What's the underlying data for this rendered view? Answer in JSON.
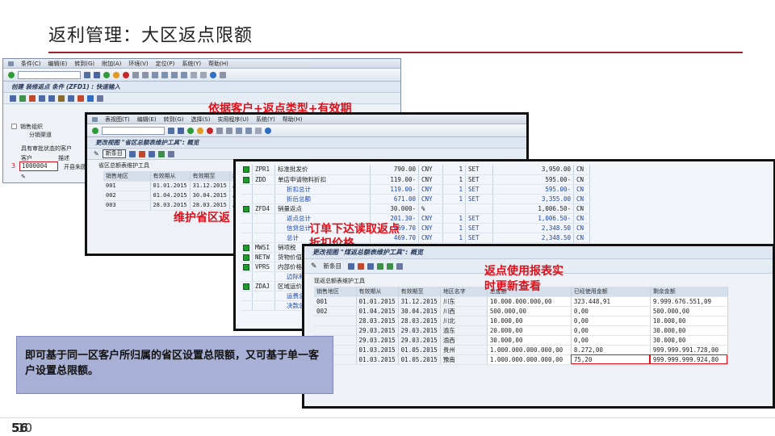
{
  "slide": {
    "title": "返利管理：大区返点限额",
    "page_number": "56",
    "page_number_overlay": "10"
  },
  "annotations": {
    "a1": "依据客户+返点类型+有效期",
    "a2": "维护省区返",
    "a3_line1": "订单下达读取返点",
    "a3_line2": "折扣价格",
    "a4_line1": "返点使用报表实",
    "a4_line2": "时更新查看"
  },
  "note": {
    "text": "即可基于同一区客户所归属的省区设置总限额，又可基于单一客户设置总限额。"
  },
  "win1": {
    "menu": [
      "条件(C)",
      "编辑(E)",
      "转到(G)",
      "附加(A)",
      "环境(V)",
      "定位(P)",
      "系统(Y)",
      "帮助(H)"
    ],
    "title": "创建 装修返点 条件 (ZFD1) : 快速输入",
    "field1_label": "销售组织",
    "field2_label": "分销渠道",
    "section_label": "具有审批状态的客户",
    "col_customer": "客户",
    "col_desc": "描述",
    "customer_value": "1000004",
    "customer_desc": "开县朱圆",
    "row_marker": "3"
  },
  "win2": {
    "menu": [
      "表视图(T)",
      "编辑(E)",
      "转到(G)",
      "选择(S)",
      "实用程序(U)",
      "系统(Y)",
      "帮助(H)"
    ],
    "title": "更改视图 \"省区总额表维护工具\": 概览",
    "new_entry": "新条目",
    "table_title": "省区总额表维护工具",
    "headers": [
      "销售地区",
      "有效期从",
      "有效期至",
      "地区名字"
    ],
    "rows": [
      [
        "001",
        "01.01.2015",
        "31.12.2015",
        "川东"
      ],
      [
        "002",
        "01.04.2015",
        "30.04.2015",
        "川西"
      ],
      [
        "003",
        "28.03.2015",
        "28.03.2015",
        "川北"
      ]
    ]
  },
  "win3": {
    "rows": [
      {
        "code": "ZPR1",
        "desc": "标准批发价",
        "amount": "790.00",
        "cur": "CNY",
        "per": "1",
        "unit": "SET",
        "value": "3,950.00",
        "cur2": "CN",
        "green": true,
        "blue": false
      },
      {
        "code": "ZDD",
        "desc": "单店申请物料折扣",
        "amount": "119.00-",
        "cur": "CNY",
        "per": "1",
        "unit": "SET",
        "value": "595.00-",
        "cur2": "CN",
        "green": true,
        "blue": false
      },
      {
        "code": "",
        "desc": "折扣总计",
        "amount": "119.00-",
        "cur": "CNY",
        "per": "1",
        "unit": "SET",
        "value": "595.00-",
        "cur2": "CN",
        "green": false,
        "blue": true
      },
      {
        "code": "",
        "desc": "折后总额",
        "amount": "671.00",
        "cur": "CNY",
        "per": "1",
        "unit": "SET",
        "value": "3,355.00",
        "cur2": "CN",
        "green": false,
        "blue": true
      },
      {
        "code": "ZFD4",
        "desc": "销量返点",
        "amount": "30.000-",
        "cur": "%",
        "per": "",
        "unit": "",
        "value": "1,006.50-",
        "cur2": "CN",
        "green": true,
        "blue": false
      },
      {
        "code": "",
        "desc": "返点总计",
        "amount": "201.30-",
        "cur": "CNY",
        "per": "1",
        "unit": "SET",
        "value": "1,006.50-",
        "cur2": "CN",
        "green": false,
        "blue": true
      },
      {
        "code": "",
        "desc": "信贷总计",
        "amount": "469.70",
        "cur": "CNY",
        "per": "1",
        "unit": "SET",
        "value": "2,348.50",
        "cur2": "CN",
        "green": false,
        "blue": true
      },
      {
        "code": "",
        "desc": "总计",
        "amount": "469.70",
        "cur": "CNY",
        "per": "1",
        "unit": "SET",
        "value": "2,348.50",
        "cur2": "CN",
        "green": false,
        "blue": true
      },
      {
        "code": "MWSI",
        "desc": "销项税",
        "amount": "",
        "cur": "",
        "per": "",
        "unit": "",
        "value": "",
        "cur2": "",
        "green": true,
        "blue": false
      },
      {
        "code": "NETW",
        "desc": "货物价值",
        "amount": "",
        "cur": "",
        "per": "",
        "unit": "",
        "value": "",
        "cur2": "",
        "green": true,
        "blue": false
      },
      {
        "code": "VPRS",
        "desc": "内部价格",
        "amount": "",
        "cur": "",
        "per": "",
        "unit": "",
        "value": "",
        "cur2": "",
        "green": true,
        "blue": false
      },
      {
        "code": "",
        "desc": "边际利润",
        "amount": "",
        "cur": "",
        "per": "",
        "unit": "",
        "value": "",
        "cur2": "",
        "green": false,
        "blue": true
      },
      {
        "code": "ZDAJ",
        "desc": "区域运价",
        "amount": "",
        "cur": "",
        "per": "",
        "unit": "",
        "value": "",
        "cur2": "",
        "green": true,
        "blue": false
      },
      {
        "code": "",
        "desc": "运费总计",
        "amount": "",
        "cur": "",
        "per": "",
        "unit": "",
        "value": "",
        "cur2": "",
        "green": false,
        "blue": true
      },
      {
        "code": "",
        "desc": "决款总计",
        "amount": "",
        "cur": "",
        "per": "",
        "unit": "",
        "value": "",
        "cur2": "",
        "green": false,
        "blue": true
      }
    ]
  },
  "win4": {
    "title": "更改视图 \"煤返总额表维护工具\": 概览",
    "new_entry": "新条目",
    "table_title": "现返总额表维护工具",
    "headers": [
      "销售地区",
      "有效期从",
      "有效期至",
      "地区名字",
      "总金额",
      "已经使用金额",
      "剩余金额"
    ],
    "rows": [
      [
        "001",
        "01.01.2015",
        "31.12.2015",
        "川东",
        "10.000.000.000,00",
        "323.448,91",
        "9.999.676.551,09"
      ],
      [
        "002",
        "01.04.2015",
        "30.04.2015",
        "川西",
        "500.000,00",
        "0,00",
        "500.000,00"
      ],
      [
        "",
        "28.03.2015",
        "28.03.2015",
        "川北",
        "10.000,00",
        "0,00",
        "10.000,00"
      ],
      [
        "",
        "29.03.2015",
        "29.03.2015",
        "渝东",
        "20.000,00",
        "0,00",
        "30.000,00"
      ],
      [
        "",
        "29.03.2015",
        "29.03.2015",
        "渝西",
        "30.000,00",
        "0,00",
        "30.000,00"
      ],
      [
        "",
        "01.03.2015",
        "01.05.2015",
        "贵州",
        "1.000.000.000.000,00",
        "8.272,00",
        "999.999.991.728,00"
      ],
      [
        "",
        "01.03.2015",
        "01.05.2015",
        "豫南",
        "1.000.000.000.000,00",
        "75,20",
        "999.999.999.924,80"
      ]
    ]
  },
  "colors": {
    "accent_red": "#a0202f",
    "annotation_red": "#e0101a",
    "note_bg": "#a9b0d6",
    "sap_green": "#1f9b2e"
  }
}
